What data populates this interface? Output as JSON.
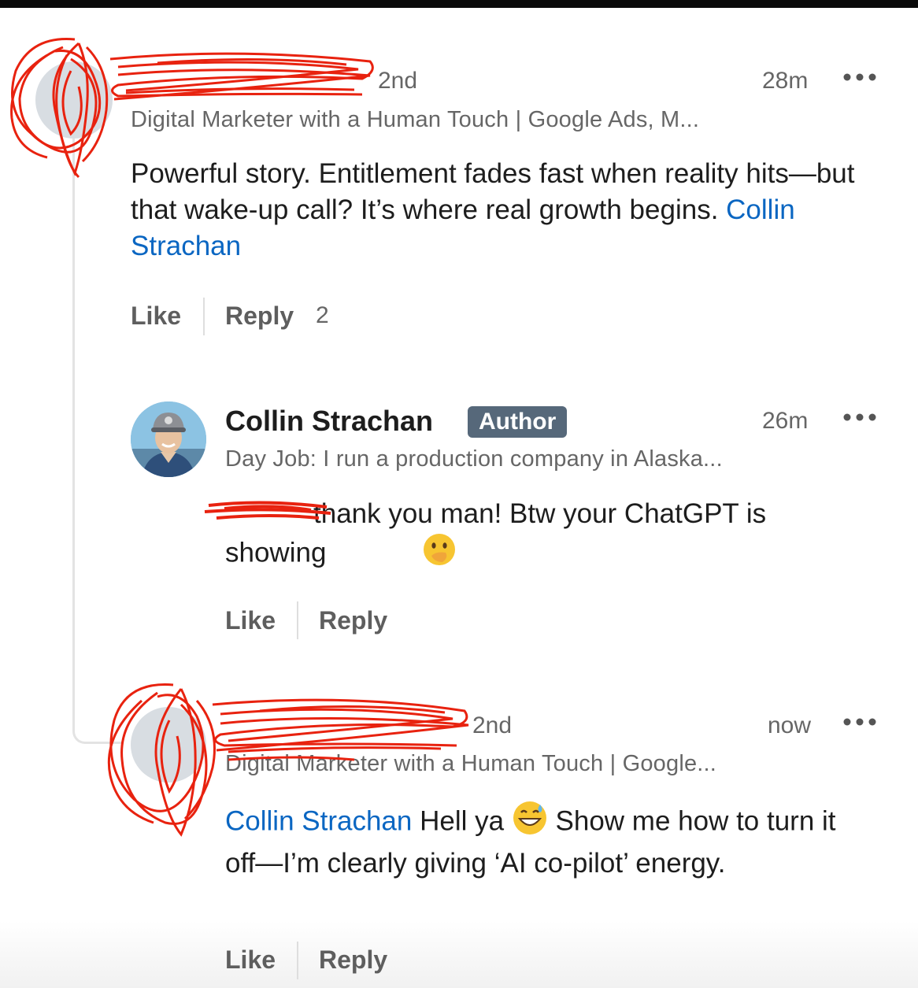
{
  "comments": [
    {
      "degree": "2nd",
      "headline": "Digital Marketer with a Human Touch | Google Ads, M...",
      "time": "28m",
      "more_icon": "more-horizontal-icon",
      "body": "Powerful story. Entitlement fades fast when reality hits—but that wake-up call? It’s where real growth begins.",
      "mention": "Collin Strachan",
      "like_label": "Like",
      "reply_label": "Reply",
      "reply_count": "2"
    },
    {
      "name": "Collin Strachan",
      "badge": "Author",
      "headline": "Day Job: I run a production company in Alaska...",
      "time": "26m",
      "more_icon": "more-horizontal-icon",
      "body": "thank you man! Btw your ChatGPT is showing",
      "emoji": "face-with-hand-over-mouth-emoji",
      "like_label": "Like",
      "reply_label": "Reply"
    },
    {
      "degree": "2nd",
      "headline": "Digital Marketer with a Human Touch | Google...",
      "time": "now",
      "more_icon": "more-horizontal-icon",
      "mention": "Collin Strachan",
      "body_part1": "Hell ya",
      "emoji": "grinning-face-with-sweat-emoji",
      "body_part2": "Show me how to turn it off—I’m clearly giving ‘AI co-pilot’ energy.",
      "like_label": "Like",
      "reply_label": "Reply"
    }
  ],
  "colors": {
    "link": "#0a66c2",
    "redaction": "#e8220f",
    "author_badge": "#56687a"
  }
}
